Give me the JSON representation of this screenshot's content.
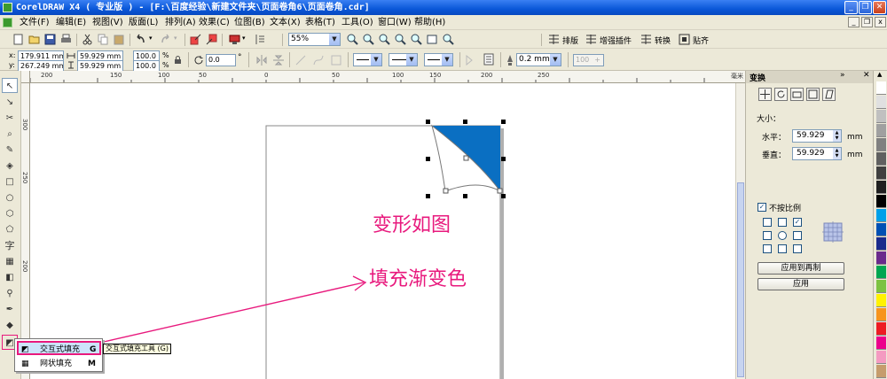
{
  "window": {
    "title": "CorelDRAW X4 ( 专业版 ) - [F:\\百度经验\\新建文件夹\\页面卷角6\\页面卷角.cdr]",
    "minimize": "_",
    "restore": "❐",
    "close": "✕"
  },
  "menu": {
    "items": [
      "文件(F)",
      "编辑(E)",
      "视图(V)",
      "版面(L)",
      "排列(A)",
      "效果(C)",
      "位图(B)",
      "文本(X)",
      "表格(T)",
      "工具(O)",
      "窗口(W)",
      "帮助(H)"
    ],
    "doc_minimize": "_",
    "doc_restore": "❐",
    "doc_close": "x"
  },
  "toolbar": {
    "zoom": "55%",
    "buttons": [
      "排版",
      "增强插件",
      "转换",
      "贴齐"
    ]
  },
  "property_bar": {
    "x": "179.911 mm",
    "y": "267.249 mm",
    "width": "59.929 mm",
    "height": "59.929 mm",
    "scale_x": "100.0",
    "scale_y": "100.0",
    "percent": "%",
    "angle": "0.0",
    "degree": "°",
    "outline_width": "0.2 mm",
    "spin_value": "100"
  },
  "rulers": {
    "unit": "毫米",
    "h_labels": [
      "200",
      "150",
      "100",
      "50",
      "0",
      "50",
      "100",
      "150",
      "200",
      "250"
    ],
    "v_labels": [
      "300",
      "250",
      "200"
    ]
  },
  "docker": {
    "title": "变换",
    "size_label": "大小：",
    "h_label": "水平：",
    "h_value": "59.929",
    "v_label": "垂直：",
    "v_value": "59.929",
    "unit": "mm",
    "keep_ratio_label": "不按比例",
    "apply_dup_label": "应用到再制",
    "apply_label": "应用"
  },
  "canvas": {
    "annotation_1": "变形如图",
    "annotation_2": "填充渐变色"
  },
  "flyout": {
    "item1_label": "交互式填充",
    "item1_key": "G",
    "item2_label": "网状填充",
    "item2_key": "M",
    "tooltip": "交互式填充工具 (G)"
  },
  "colors": {
    "fill_blue": "#0a6fc2",
    "annotation_pink": "#e8197d",
    "titlebar_blue": "#0a57d8"
  },
  "palette": [
    "#ffffff",
    "#e0e0e0",
    "#c0c0c0",
    "#a0a0a0",
    "#808080",
    "#606060",
    "#404040",
    "#202020",
    "#000000",
    "#00a0e9",
    "#0050b4",
    "#1a2a8c",
    "#6a2a8c",
    "#00a651",
    "#7dc242",
    "#fff200",
    "#f7941d",
    "#ed1c24",
    "#ec008c",
    "#f49ac1",
    "#c69c6d"
  ]
}
